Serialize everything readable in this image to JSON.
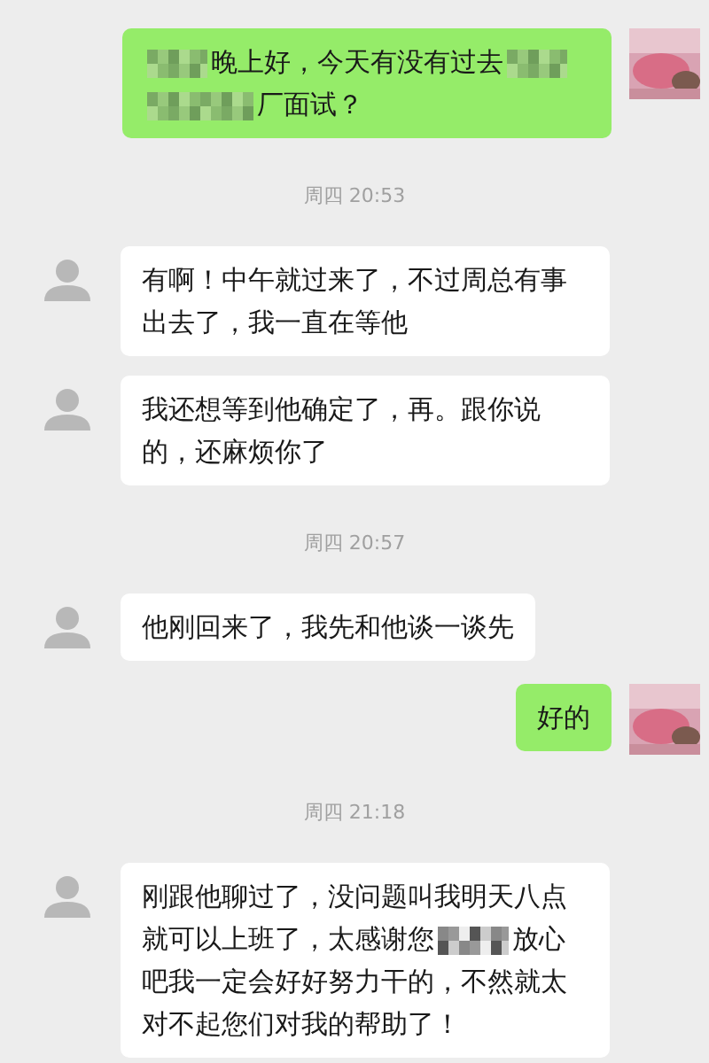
{
  "messages": [
    {
      "kind": "outgoing",
      "segments": [
        {
          "kind": "mosaic"
        },
        {
          "kind": "text",
          "text": "晚上好，今天有没有过去"
        },
        {
          "kind": "mosaic"
        },
        {
          "kind": "mosaic_long"
        },
        {
          "kind": "text",
          "text": "厂面试？"
        }
      ]
    },
    {
      "kind": "time",
      "text": "周四 20:53"
    },
    {
      "kind": "incoming",
      "segments": [
        {
          "kind": "text",
          "text": "有啊！中午就过来了，不过周总有事出去了，我一直在等他"
        }
      ]
    },
    {
      "kind": "incoming",
      "segments": [
        {
          "kind": "text",
          "text": "我还想等到他确定了，再。跟你说的，还麻烦你了"
        }
      ]
    },
    {
      "kind": "time",
      "text": "周四 20:57"
    },
    {
      "kind": "incoming",
      "segments": [
        {
          "kind": "text",
          "text": "他刚回来了，我先和他谈一谈先"
        }
      ]
    },
    {
      "kind": "outgoing",
      "segments": [
        {
          "kind": "text",
          "text": "好的"
        }
      ]
    },
    {
      "kind": "time",
      "text": "周四 21:18"
    },
    {
      "kind": "incoming",
      "segments": [
        {
          "kind": "text",
          "text": "刚跟他聊过了，没问题叫我明天八点就可以上班了，太感谢您"
        },
        {
          "kind": "mosaic"
        },
        {
          "kind": "text",
          "text": "放心吧我一定会好好努力干的，不然就太对不起您们对我的帮助了！"
        }
      ]
    }
  ]
}
